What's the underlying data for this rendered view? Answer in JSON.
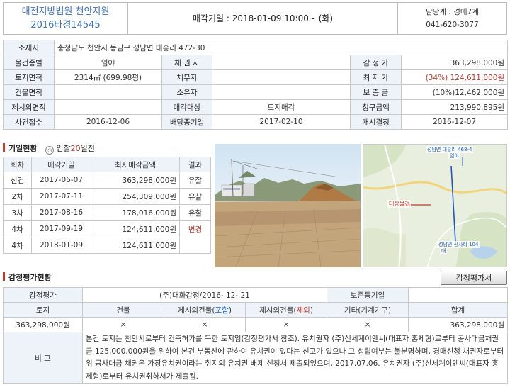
{
  "header": {
    "court": "대전지방법원 천안지원",
    "case_no": "2016타경14545",
    "sale_date": "매각기일 : 2018-01-09  10:00~ (화)",
    "dept": "담당계 : 경매7계",
    "phone": "041-620-3077"
  },
  "info": {
    "address_label": "소재지",
    "address": "충청남도 천안시 동남구 성남면 대흥리 472-30",
    "row1": [
      "물건종별",
      "임야",
      "채 권 자",
      "",
      "감 정 가",
      "363,298,000원"
    ],
    "row2": [
      "토지면적",
      "2314㎡ (699.98평)",
      "채무자",
      "",
      "최 저 가",
      "(34%) 124,611,000원"
    ],
    "row3": [
      "건물면적",
      "",
      "소유자",
      "",
      "보 증 금",
      "(10%)12,462,000원"
    ],
    "row4": [
      "제시외면적",
      "",
      "매각대상",
      "토지매각",
      "청구금액",
      "213,990,895원"
    ],
    "row5": [
      "사건접수",
      "2016-12-06",
      "배당종기일",
      "2017-02-10",
      "개시결정",
      "2016-12-07"
    ]
  },
  "history": {
    "title": "기일현황",
    "note_prefix": "입찰",
    "note_days": "20",
    "note_suffix": "일전",
    "headers": [
      "회차",
      "매각기일",
      "최저매각금액",
      "결과"
    ],
    "rows": [
      [
        "신건",
        "2017-06-07",
        "363,298,000원",
        "유찰"
      ],
      [
        "2차",
        "2017-07-11",
        "254,309,000원",
        "유찰"
      ],
      [
        "3차",
        "2017-08-16",
        "178,016,000원",
        "유찰"
      ],
      [
        "4차",
        "2017-09-19",
        "124,611,000원",
        "변경"
      ],
      [
        "4차",
        "2018-01-09",
        "124,611,000원",
        ""
      ]
    ]
  },
  "map": {
    "label_top_1": "성남면 대흥리 468-4",
    "label_top_2": "임야",
    "label_target": "대상물건",
    "label_bottom_1": "성남면 신사리 104",
    "label_bottom_2": "대"
  },
  "appraisal": {
    "title": "감정평가현황",
    "button": "감정평가서",
    "label": "감정평가",
    "agency": "(주)대화감정/2016- 12- 21",
    "keep_label": "보존등기일",
    "keep_value": "",
    "cols": {
      "land": "토지",
      "building": "건물",
      "extra_incl_a": "제시외건물(",
      "extra_incl_b": "포함",
      "extra_incl_c": ")",
      "extra_excl_a": "제시외건물(",
      "extra_excl_b": "제외",
      "extra_excl_c": ")",
      "etc": "기타(기계기구)",
      "total": "합계"
    },
    "vals": [
      "363,298,000원",
      "×",
      "×",
      "×",
      "×",
      "363,298,000원"
    ],
    "remark_label": "비 고",
    "remark": "본건 토지는 천안시로부터 건축허가를 득한 토지임(감정평가서 참조). 유치권자 (주)신세계이엔씨(대표자 홍제형)로부터 공사대금채권 금 125,000,000원을 위하여 본건 부동산에 관하여 유치권이 있다는 신고가 있으나 그 성립여부는 불분명하며, 경매신청 채권자로부터 위 공사대금 채권은 가장유치권이라는 취지의 유치권 배제 신청서 제출되었으며, 2017.07.06. 유치권자 (주)신세계이엔씨(대표자 홍제형)로부터 유치권취하서가 제출됨."
  },
  "colors": {
    "accent": "#3a6fc1",
    "alert": "#c0392b",
    "label_bg": "#eef3fa"
  }
}
